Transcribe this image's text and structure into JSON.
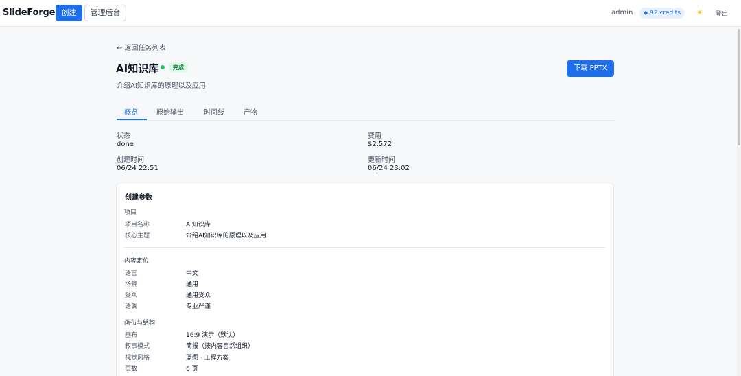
{
  "header": {
    "brand": "SlideForge",
    "nav_create": "创建",
    "nav_admin": "管理后台",
    "user": "admin",
    "credits_icon": "diamond-icon",
    "credits": "92 credits",
    "theme_icon": "sun-icon",
    "logout": "登出"
  },
  "page": {
    "back": "← 返回任务列表",
    "title": "AI知识库",
    "status_badge": "完成",
    "subtitle": "介绍AI知识库的原理以及应用",
    "download": "下载 PPTX"
  },
  "tabs": [
    {
      "label": "概览",
      "active": true
    },
    {
      "label": "原始输出"
    },
    {
      "label": "时间线"
    },
    {
      "label": "产物"
    }
  ],
  "overview": {
    "status_label": "状态",
    "status_value": "done",
    "cost_label": "费用",
    "cost_value": "$2.572",
    "created_label": "创建时间",
    "created_value": "06/24 22:51",
    "updated_label": "更新时间",
    "updated_value": "06/24 23:02"
  },
  "params": {
    "title": "创建参数",
    "project": {
      "heading": "项目",
      "rows": [
        {
          "key": "项目名称",
          "value": "AI知识库"
        },
        {
          "key": "核心主题",
          "value": "介绍AI知识库的原理以及应用"
        }
      ]
    },
    "positioning": {
      "heading": "内容定位",
      "rows": [
        {
          "key": "语言",
          "value": "中文"
        },
        {
          "key": "场景",
          "value": "通用"
        },
        {
          "key": "受众",
          "value": "通用受众"
        },
        {
          "key": "语调",
          "value": "专业严谨"
        }
      ]
    },
    "canvas": {
      "heading": "画布与结构",
      "rows": [
        {
          "key": "画布",
          "value": "16:9 演示（默认）"
        },
        {
          "key": "叙事模式",
          "value": "简报（按内容自然组织）"
        },
        {
          "key": "视觉风格",
          "value": "蓝图 · 工程方案"
        },
        {
          "key": "页数",
          "value": "6 页"
        }
      ]
    }
  },
  "colors": {
    "accent": "#1f6feb",
    "success": "#22c55e",
    "success_bg": "#dcfce7"
  }
}
